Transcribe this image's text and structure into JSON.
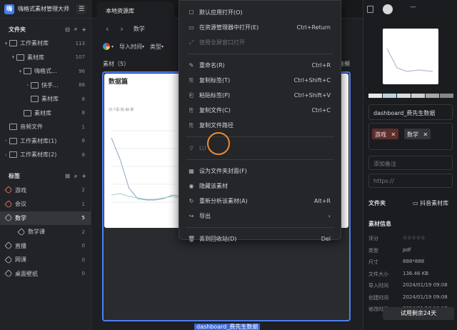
{
  "app": {
    "title": "嗨格式素材管理大师",
    "logo": "嗨"
  },
  "sidebar": {
    "folders_title": "文件夹",
    "folders": [
      {
        "label": "工作素材库",
        "count": "113",
        "arrow": "▾",
        "indent": 0
      },
      {
        "label": "素材库",
        "count": "107",
        "arrow": "▾",
        "indent": 1
      },
      {
        "label": "嗨格式...",
        "count": "96",
        "arrow": "▾",
        "indent": 2
      },
      {
        "label": "快手...",
        "count": "88",
        "arrow": "›",
        "indent": 3
      },
      {
        "label": "素材库",
        "count": "8",
        "arrow": "",
        "indent": 3
      },
      {
        "label": "素材库",
        "count": "8",
        "arrow": "",
        "indent": 2
      },
      {
        "label": "音频文件",
        "count": "1",
        "arrow": "",
        "indent": 0
      },
      {
        "label": "工作素材库(1)",
        "count": "8",
        "arrow": "›",
        "indent": 0
      },
      {
        "label": "工作素材库(2)",
        "count": "8",
        "arrow": "›",
        "indent": 0
      }
    ],
    "tags_title": "标签",
    "tags": [
      {
        "label": "游戏",
        "count": "2",
        "indent": 0,
        "color": "#e06a5c"
      },
      {
        "label": "会议",
        "count": "1",
        "indent": 0,
        "color": "#e06a5c"
      },
      {
        "label": "数学",
        "count": "5",
        "indent": 0,
        "color": "#9fa0a5",
        "selected": true
      },
      {
        "label": "数学课",
        "count": "2",
        "indent": 1,
        "color": "#9fa0a5"
      },
      {
        "label": "直播",
        "count": "0",
        "indent": 0,
        "color": "#9fa0a5"
      },
      {
        "label": "网课",
        "count": "0",
        "indent": 0,
        "color": "#9fa0a5"
      },
      {
        "label": "桌面壁纸",
        "count": "0",
        "indent": 0,
        "color": "#9fa0a5"
      }
    ]
  },
  "tab": {
    "label": "本地资源库"
  },
  "toolbar": {
    "back": "‹",
    "forward": "›",
    "breadcrumb": "数学"
  },
  "filter": {
    "time": "导入时间",
    "type": "类型"
  },
  "content": {
    "count_label": "素材（5）",
    "audio_label": "音频",
    "file_name": "dashboard_费先生数据"
  },
  "menu": {
    "items": [
      {
        "icon": "☐",
        "label": "默认应用打开(O)",
        "shortcut": "",
        "group": 1
      },
      {
        "icon": "▭",
        "label": "在资源管理器中打开(E)",
        "shortcut": "Ctrl+Return",
        "group": 1
      },
      {
        "icon": "⤢",
        "label": "使用全屏窗口打开",
        "shortcut": "",
        "group": 1,
        "disabled": true
      },
      {
        "icon": "✎",
        "label": "重命名(R)",
        "shortcut": "Ctrl+R",
        "group": 2
      },
      {
        "icon": "⎘",
        "label": "复制标签(T)",
        "shortcut": "Ctrl+Shift+C",
        "group": 2
      },
      {
        "icon": "⎗",
        "label": "粘贴标签(P)",
        "shortcut": "Ctrl+Shift+V",
        "group": 2
      },
      {
        "icon": "⎘",
        "label": "复制文件(C)",
        "shortcut": "Ctrl+C",
        "group": 2
      },
      {
        "icon": "⎘",
        "label": "复制文件路径",
        "shortcut": "",
        "group": 2
      },
      {
        "icon": "⚲",
        "label": "LU",
        "shortcut": "",
        "group": 3,
        "disabled": true
      },
      {
        "icon": "▦",
        "label": "设为文件夹封面(F)",
        "shortcut": "",
        "group": 4
      },
      {
        "icon": "◉",
        "label": "隐藏该素材",
        "shortcut": "",
        "group": 4
      },
      {
        "icon": "↻",
        "label": "重新分析该素材(A)",
        "shortcut": "Alt+R",
        "group": 4
      },
      {
        "icon": "↪",
        "label": "导出",
        "shortcut": "›",
        "group": 4
      },
      {
        "icon": "🗑",
        "label": "丢到回收站(D)",
        "shortcut": "Del",
        "group": 5
      }
    ]
  },
  "right": {
    "file_name": "dashboard_费先生数据",
    "swatches": [
      "#e8e8e8",
      "#b9d3db",
      "#dcdcdc",
      "#cfcfcf",
      "#a8a8a8",
      "#888888"
    ],
    "tags": [
      {
        "label": "游戏",
        "bg": "#5c2e2c"
      },
      {
        "label": "数学",
        "bg": "#35363a"
      }
    ],
    "note_placeholder": "添加备注",
    "url_placeholder": "https://",
    "folder_label": "文件夹",
    "folder_value": "抖音素材库",
    "info_title": "素材信息",
    "info": [
      {
        "k": "评分",
        "v": "☆☆☆☆☆"
      },
      {
        "k": "类型",
        "v": "pdf"
      },
      {
        "k": "尺寸",
        "v": "888*888"
      },
      {
        "k": "文件大小",
        "v": "136.46 KB"
      },
      {
        "k": "导入时间",
        "v": "2024/01/19 09:08"
      },
      {
        "k": "创建时间",
        "v": "2024/01/19 09:08"
      },
      {
        "k": "修改时间",
        "v": "2024/01/19 10:17"
      }
    ],
    "trial": "试用剩余24天"
  },
  "chart_data": {
    "type": "line",
    "title": "数据篇",
    "subtitle": "创-7毫-独-触-聚",
    "series": [
      {
        "values": [
          90,
          60,
          20,
          5,
          3,
          3,
          5,
          10,
          8,
          3
        ]
      },
      {
        "values": [
          10,
          12,
          8,
          6,
          4,
          4,
          6,
          8,
          5,
          3
        ]
      }
    ]
  }
}
